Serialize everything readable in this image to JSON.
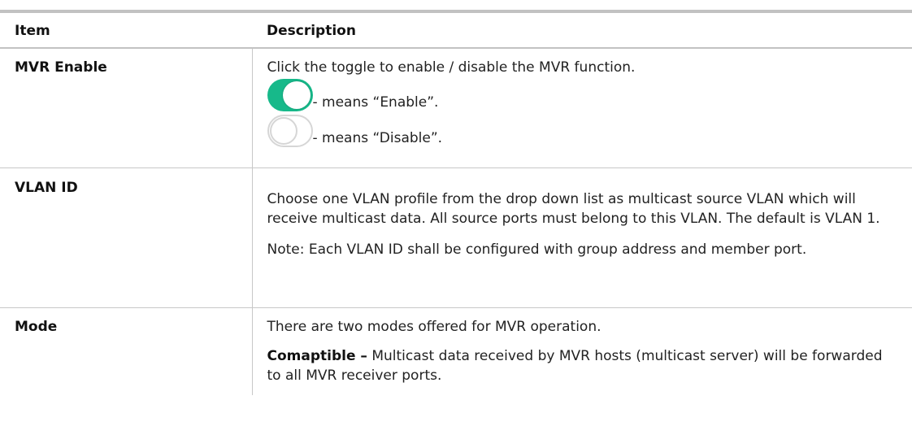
{
  "table": {
    "headers": {
      "item": "Item",
      "description": "Description"
    },
    "rows": {
      "mvr_enable": {
        "item": "MVR Enable",
        "text": "Click the toggle to enable / disable the MVR function.",
        "toggle_on_caption": "- means “Enable”.",
        "toggle_off_caption": "- means “Disable”.",
        "toggle_on_color": "#17b98a"
      },
      "vlan_id": {
        "item": "VLAN ID",
        "text": "Choose one VLAN profile from the drop down list as multicast source VLAN which will receive multicast data. All source ports must belong to this VLAN. The default is VLAN 1.",
        "note": "Note: Each VLAN ID shall be configured with group address and member port."
      },
      "mode": {
        "item": "Mode",
        "text": "There are two modes offered for MVR operation.",
        "compatible_label": "Comaptible –",
        "compatible_text": " Multicast data received by MVR hosts (multicast server) will be forwarded to all MVR receiver ports."
      }
    }
  }
}
